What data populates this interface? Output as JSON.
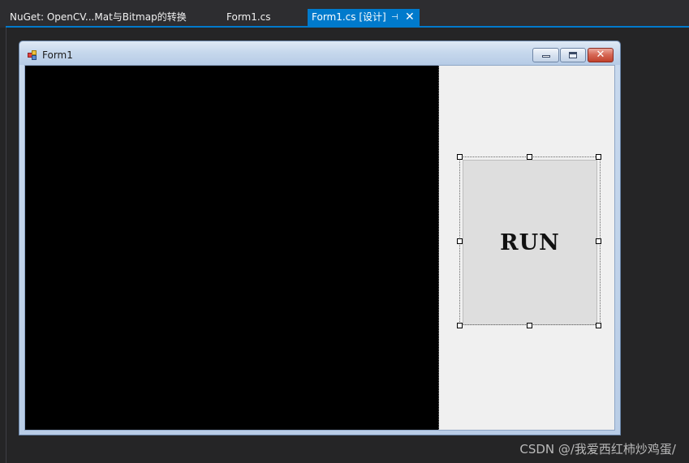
{
  "ide": {
    "tabs": [
      {
        "label": "NuGet: OpenCV...Mat与Bitmap的转换",
        "active": false
      },
      {
        "label": "Form1.cs",
        "active": false
      },
      {
        "label": "Form1.cs [设计]",
        "active": true
      }
    ],
    "pin_glyph": "⊣",
    "close_glyph": "✕",
    "accent_color": "#007acc",
    "background_color": "#252526"
  },
  "form": {
    "title": "Form1",
    "picture_box_color": "#000000",
    "run_button_label": "RUN",
    "caption_buttons": [
      "minimize",
      "maximize",
      "close"
    ]
  },
  "watermark": "CSDN @/我爱西红柿炒鸡蛋/"
}
